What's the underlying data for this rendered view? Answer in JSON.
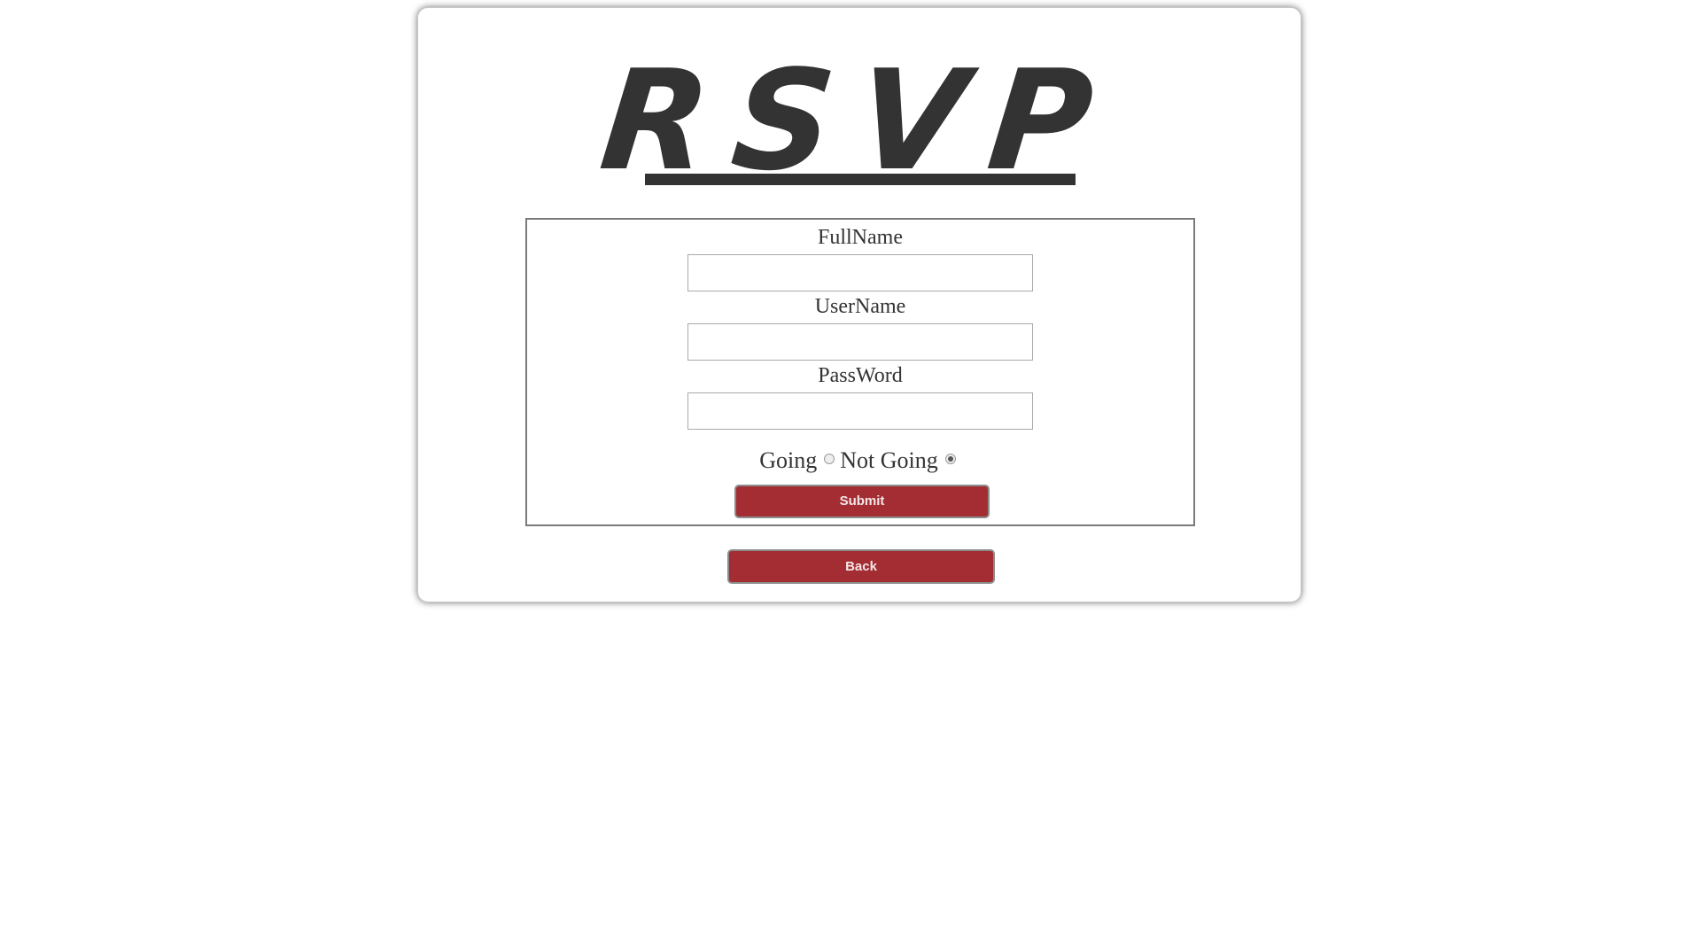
{
  "page": {
    "title": "RSVP"
  },
  "form": {
    "fullname_label": "FullName",
    "fullname_value": "",
    "username_label": "UserName",
    "username_value": "",
    "password_label": "PassWord",
    "password_value": "",
    "attendance": {
      "going_label": "Going",
      "not_going_label": "Not Going",
      "selected": "Not Going"
    },
    "submit_label": "Submit"
  },
  "back_label": "Back",
  "colors": {
    "button_bg": "#a32d33",
    "text": "#333333"
  }
}
